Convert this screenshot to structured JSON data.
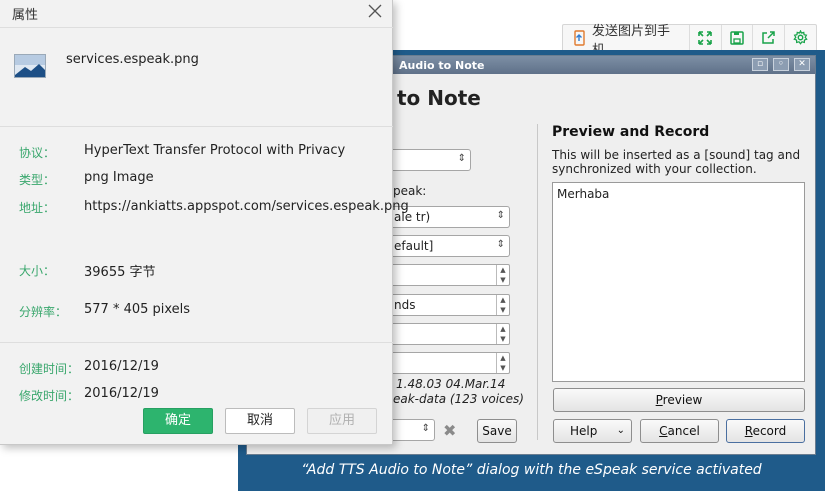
{
  "toolbar": {
    "send_label": "发送图片到手机",
    "icons": [
      "phone-send-icon",
      "fullscreen-icon",
      "save-icon",
      "share-icon",
      "settings-icon"
    ],
    "accent": "#19a34a"
  },
  "anki": {
    "window_title": "Audio to Note",
    "heading": "to Note",
    "left": {
      "speak_label": "peak:",
      "voice_value": "ale tr)",
      "variant_value": "efault]",
      "speed_value": "nds",
      "version_line1": "1.48.03  04.Mar.14",
      "version_line2": "eak-data (123 voices)",
      "save_button": "Save"
    },
    "preview": {
      "title": "Preview and Record",
      "description": "This will be inserted as a [sound] tag and synchronized with your collection.",
      "text": "Merhaba",
      "preview_button": "Preview",
      "help_button": "Help",
      "cancel_button": "Cancel",
      "record_button": "Record"
    },
    "caption": "“Add TTS Audio to Note” dialog with the eSpeak service activated",
    "frame_color": "#1f5b8a"
  },
  "props": {
    "title": "属性",
    "file_name": "services.espeak.png",
    "protocol_key": "协议：",
    "protocol_value": "HyperText Transfer Protocol with Privacy",
    "type_key": "类型：",
    "type_value": "png Image",
    "address_key": "地址：",
    "address_value": "https://ankiatts.appspot.com/services.espeak.png",
    "size_key": "大小：",
    "size_value": "39655 字节",
    "resolution_key": "分辨率：",
    "resolution_value": "577 * 405 pixels",
    "created_key": "创建时间：",
    "created_value": "2016/12/19",
    "modified_key": "修改时间：",
    "modified_value": "2016/12/19",
    "ok_button": "确定",
    "cancel_button": "取消",
    "apply_button": "应用",
    "key_color": "#3aa76d",
    "ok_color": "#2db46e"
  }
}
